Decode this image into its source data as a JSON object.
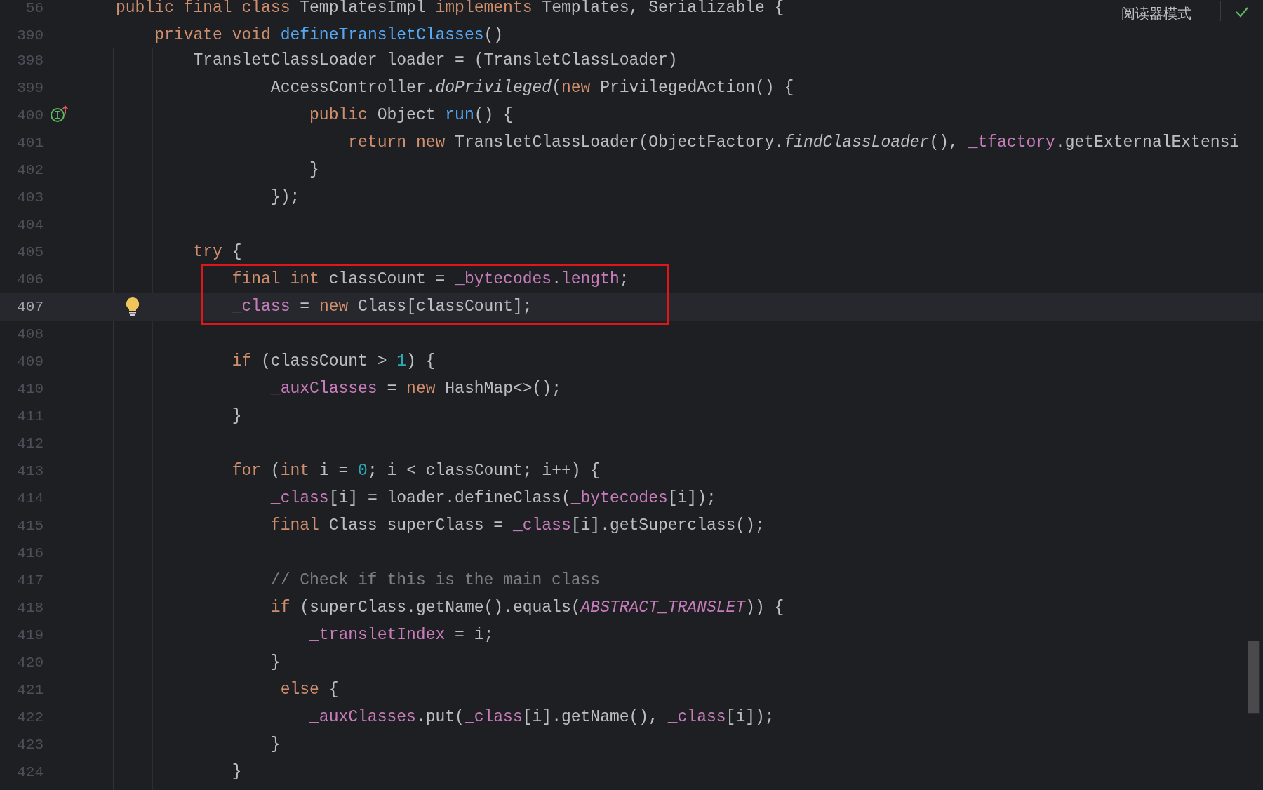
{
  "sticky_header": {
    "lines": [
      {
        "number": "56",
        "tokens": [
          {
            "text": "public final class",
            "kind": "kw"
          },
          {
            "text": " TemplatesImpl ",
            "kind": "plain"
          },
          {
            "text": "implements",
            "kind": "kw"
          },
          {
            "text": " Templates, Serializable {",
            "kind": "plain"
          }
        ]
      },
      {
        "number": "390",
        "tokens": [
          {
            "text": "    private void ",
            "kind": "kw"
          },
          {
            "text": "defineTransletClasses",
            "kind": "method"
          },
          {
            "text": "()",
            "kind": "plain"
          }
        ]
      }
    ]
  },
  "reader_mode": {
    "label": "阅读器模式"
  },
  "lines": [
    {
      "number": "398",
      "current": false,
      "boxed": false,
      "tokens": [
        {
          "text": "        TransletClassLoader loader = (TransletClassLoader)",
          "kind": "plain"
        }
      ]
    },
    {
      "number": "399",
      "current": false,
      "boxed": false,
      "tokens": [
        {
          "text": "                AccessController.",
          "kind": "plain"
        },
        {
          "text": "doPrivileged",
          "kind": "static"
        },
        {
          "text": "(",
          "kind": "plain"
        },
        {
          "text": "new",
          "kind": "kw"
        },
        {
          "text": " PrivilegedAction() {",
          "kind": "plain"
        }
      ]
    },
    {
      "number": "400",
      "current": false,
      "boxed": false,
      "gutter_icon": {
        "kind": "implements"
      },
      "tokens": [
        {
          "text": "                    public",
          "kind": "kw"
        },
        {
          "text": " Object ",
          "kind": "plain"
        },
        {
          "text": "run",
          "kind": "method"
        },
        {
          "text": "() {",
          "kind": "plain"
        }
      ]
    },
    {
      "number": "401",
      "current": false,
      "boxed": false,
      "tokens": [
        {
          "text": "                        return new",
          "kind": "kw"
        },
        {
          "text": " TransletClassLoader(ObjectFactory.",
          "kind": "plain"
        },
        {
          "text": "findClassLoader",
          "kind": "static"
        },
        {
          "text": "(), ",
          "kind": "plain"
        },
        {
          "text": "_tfactory",
          "kind": "field"
        },
        {
          "text": ".getExternalExtensi",
          "kind": "plain"
        }
      ]
    },
    {
      "number": "402",
      "current": false,
      "boxed": false,
      "tokens": [
        {
          "text": "                    }",
          "kind": "plain"
        }
      ]
    },
    {
      "number": "403",
      "current": false,
      "boxed": false,
      "tokens": [
        {
          "text": "                });",
          "kind": "plain"
        }
      ]
    },
    {
      "number": "404",
      "current": false,
      "boxed": false
    },
    {
      "number": "405",
      "current": false,
      "boxed": false,
      "tokens": [
        {
          "text": "        try",
          "kind": "kw"
        },
        {
          "text": " {",
          "kind": "plain"
        }
      ]
    },
    {
      "number": "406",
      "current": false,
      "boxed": true,
      "tokens": [
        {
          "text": "            final int",
          "kind": "kw"
        },
        {
          "text": " classCount = ",
          "kind": "plain"
        },
        {
          "text": "_bytecodes",
          "kind": "field"
        },
        {
          "text": ".",
          "kind": "plain"
        },
        {
          "text": "length",
          "kind": "field"
        },
        {
          "text": ";",
          "kind": "plain"
        }
      ]
    },
    {
      "number": "407",
      "current": true,
      "boxed": true,
      "gutter_icon": {
        "kind": "bulb"
      },
      "tokens": [
        {
          "text": "            _class",
          "kind": "field"
        },
        {
          "text": " = ",
          "kind": "plain"
        },
        {
          "text": "new",
          "kind": "kw"
        },
        {
          "text": " Class[classCount];",
          "kind": "plain"
        }
      ]
    },
    {
      "number": "408",
      "current": false,
      "boxed": false
    },
    {
      "number": "409",
      "current": false,
      "boxed": false,
      "tokens": [
        {
          "text": "            if",
          "kind": "kw"
        },
        {
          "text": " (classCount > ",
          "kind": "plain"
        },
        {
          "text": "1",
          "kind": "num"
        },
        {
          "text": ") {",
          "kind": "plain"
        }
      ]
    },
    {
      "number": "410",
      "current": false,
      "boxed": false,
      "tokens": [
        {
          "text": "                _auxClasses",
          "kind": "field"
        },
        {
          "text": " = ",
          "kind": "plain"
        },
        {
          "text": "new",
          "kind": "kw"
        },
        {
          "text": " HashMap<>();",
          "kind": "plain"
        }
      ]
    },
    {
      "number": "411",
      "current": false,
      "boxed": false,
      "tokens": [
        {
          "text": "            }",
          "kind": "plain"
        }
      ]
    },
    {
      "number": "412",
      "current": false,
      "boxed": false
    },
    {
      "number": "413",
      "current": false,
      "boxed": false,
      "tokens": [
        {
          "text": "            for",
          "kind": "kw"
        },
        {
          "text": " (",
          "kind": "plain"
        },
        {
          "text": "int",
          "kind": "kw"
        },
        {
          "text": " i = ",
          "kind": "plain"
        },
        {
          "text": "0",
          "kind": "num"
        },
        {
          "text": "; i < classCount; i++) {",
          "kind": "plain"
        }
      ]
    },
    {
      "number": "414",
      "current": false,
      "boxed": false,
      "tokens": [
        {
          "text": "                _class",
          "kind": "field"
        },
        {
          "text": "[i] = loader.defineClass(",
          "kind": "plain"
        },
        {
          "text": "_bytecodes",
          "kind": "field"
        },
        {
          "text": "[i]);",
          "kind": "plain"
        }
      ]
    },
    {
      "number": "415",
      "current": false,
      "boxed": false,
      "tokens": [
        {
          "text": "                final",
          "kind": "kw"
        },
        {
          "text": " Class superClass = ",
          "kind": "plain"
        },
        {
          "text": "_class",
          "kind": "field"
        },
        {
          "text": "[i].getSuperclass();",
          "kind": "plain"
        }
      ]
    },
    {
      "number": "416",
      "current": false,
      "boxed": false
    },
    {
      "number": "417",
      "current": false,
      "boxed": false,
      "tokens": [
        {
          "text": "                // Check if this is the main class",
          "kind": "comment"
        }
      ]
    },
    {
      "number": "418",
      "current": false,
      "boxed": false,
      "tokens": [
        {
          "text": "                if",
          "kind": "kw"
        },
        {
          "text": " (superClass.getName().equals(",
          "kind": "plain"
        },
        {
          "text": "ABSTRACT_TRANSLET",
          "kind": "const"
        },
        {
          "text": ")) {",
          "kind": "plain"
        }
      ]
    },
    {
      "number": "419",
      "current": false,
      "boxed": false,
      "tokens": [
        {
          "text": "                    _transletIndex",
          "kind": "field"
        },
        {
          "text": " = i;",
          "kind": "plain"
        }
      ]
    },
    {
      "number": "420",
      "current": false,
      "boxed": false,
      "tokens": [
        {
          "text": "                }",
          "kind": "plain"
        }
      ]
    },
    {
      "number": "421",
      "current": false,
      "boxed": false,
      "tokens": [
        {
          "text": "                 else",
          "kind": "kw"
        },
        {
          "text": " {",
          "kind": "plain"
        }
      ]
    },
    {
      "number": "422",
      "current": false,
      "boxed": false,
      "tokens": [
        {
          "text": "                    _auxClasses",
          "kind": "field"
        },
        {
          "text": ".put(",
          "kind": "plain"
        },
        {
          "text": "_class",
          "kind": "field"
        },
        {
          "text": "[i].getName(), ",
          "kind": "plain"
        },
        {
          "text": "_class",
          "kind": "field"
        },
        {
          "text": "[i]);",
          "kind": "plain"
        }
      ]
    },
    {
      "number": "423",
      "current": false,
      "boxed": false,
      "tokens": [
        {
          "text": "                }",
          "kind": "plain"
        }
      ]
    },
    {
      "number": "424",
      "current": false,
      "boxed": false,
      "tokens": [
        {
          "text": "            }",
          "kind": "plain"
        }
      ]
    }
  ]
}
